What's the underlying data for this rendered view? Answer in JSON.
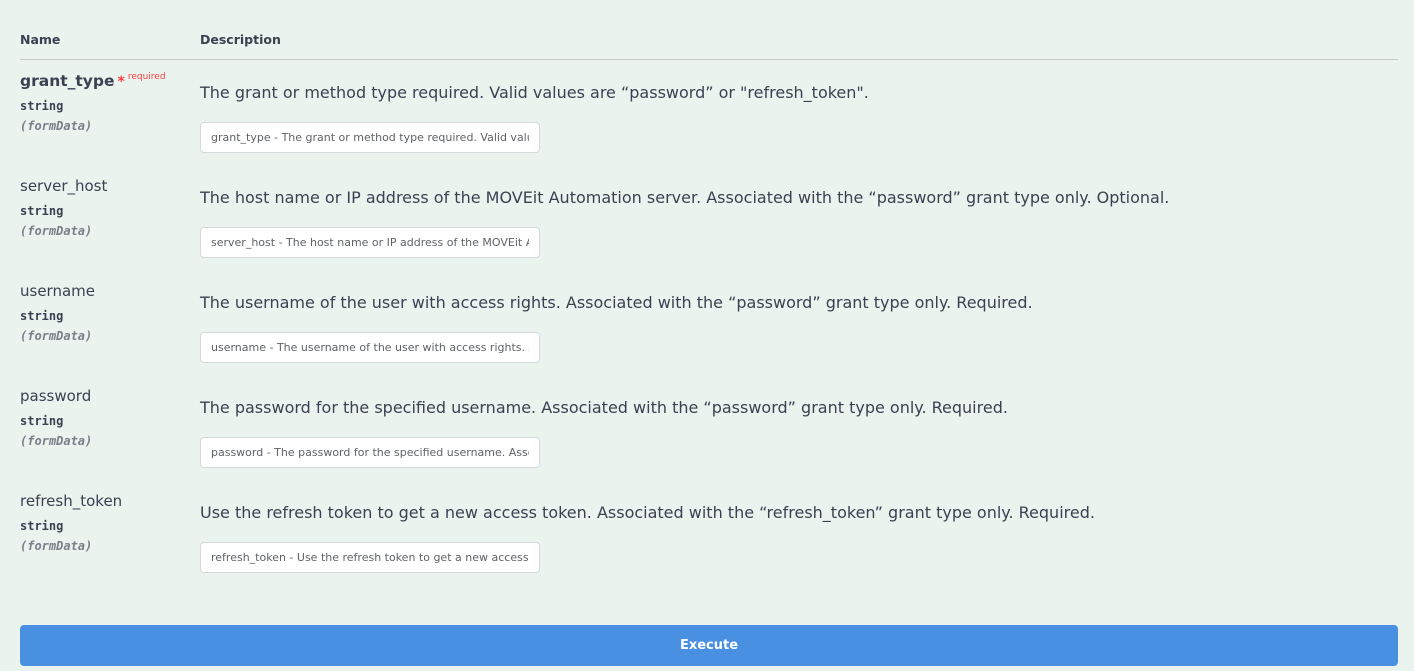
{
  "table": {
    "headers": {
      "name": "Name",
      "description": "Description"
    }
  },
  "params": [
    {
      "name": "grant_type",
      "required_star": "*",
      "required_label": "required",
      "type": "string",
      "in": "(formData)",
      "description": "The grant or method type required. Valid values are “password” or \"refresh_token\".",
      "placeholder": "grant_type - The grant or method type required. Valid values are “password” or \"refresh_token\".",
      "value": ""
    },
    {
      "name": "server_host",
      "type": "string",
      "in": "(formData)",
      "description": "The host name or IP address of the MOVEit Automation server. Associated with the “password” grant type only. Optional.",
      "placeholder": "server_host - The host name or IP address of the MOVEit Automation server. Associated with the “password” grant type only. Optional.",
      "value": ""
    },
    {
      "name": "username",
      "type": "string",
      "in": "(formData)",
      "description": "The username of the user with access rights. Associated with the “password” grant type only. Required.",
      "placeholder": "username - The username of the user with access rights. Associated with the “password” grant type only. Required.",
      "value": ""
    },
    {
      "name": "password",
      "type": "string",
      "in": "(formData)",
      "description": "The password for the specified username. Associated with the “password” grant type only. Required.",
      "placeholder": "password - The password for the specified username. Associated with the “password” grant type only. Required.",
      "value": ""
    },
    {
      "name": "refresh_token",
      "type": "string",
      "in": "(formData)",
      "description": "Use the refresh token to get a new access token. Associated with the “refresh_token” grant type only. Required.",
      "placeholder": "refresh_token - Use the refresh token to get a new access token. Associated with the “refresh_token” grant type only. Required.",
      "value": ""
    }
  ],
  "execute": {
    "label": "Execute"
  },
  "colors": {
    "background": "#ebf3ef",
    "execute_button": "#4990e2",
    "required": "#f93e3e"
  }
}
